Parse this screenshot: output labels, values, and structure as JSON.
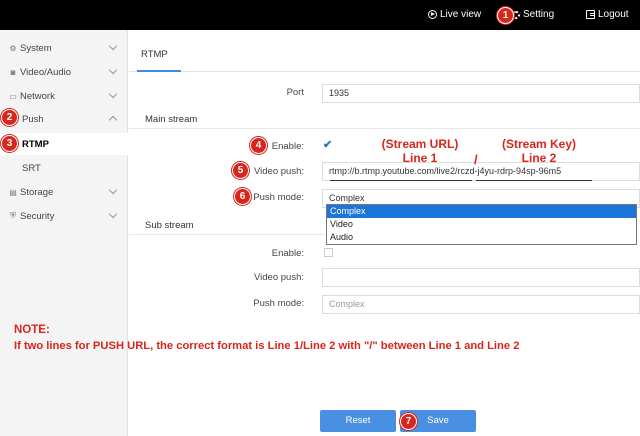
{
  "topbar": {
    "live_view": "Live view",
    "setting": "Setting",
    "logout": "Logout"
  },
  "sidebar": {
    "items": [
      {
        "label": "System",
        "icon": "gear-icon"
      },
      {
        "label": "Video/Audio",
        "icon": "camera-icon"
      },
      {
        "label": "Network",
        "icon": "monitor-icon"
      },
      {
        "label": "Push",
        "icon": ""
      },
      {
        "label": "RTMP",
        "icon": ""
      },
      {
        "label": "SRT",
        "icon": ""
      },
      {
        "label": "Storage",
        "icon": "storage-icon"
      },
      {
        "label": "Security",
        "icon": "shield-icon"
      }
    ]
  },
  "tabs": {
    "active": "RTMP"
  },
  "form": {
    "port_label": "Port",
    "port_value": "1935",
    "main_stream_title": "Main stream",
    "enable_label": "Enable:",
    "enable_checked": true,
    "video_push_label": "Video push:",
    "video_push_value": "rtmp://b.rtmp.youtube.com/live2/rczd-j4yu-rdrp-94sp-96m5",
    "push_mode_label": "Push mode:",
    "push_mode_value": "Complex",
    "push_mode_options": [
      "Complex",
      "Video",
      "Audio"
    ],
    "sub_stream_title": "Sub stream",
    "sub_enable_label": "Enable:",
    "sub_video_push_label": "Video push:",
    "sub_push_mode_label": "Push mode:",
    "sub_push_mode_value": "Complex"
  },
  "annotations": {
    "badges": [
      "1",
      "2",
      "3",
      "4",
      "5",
      "6",
      "7"
    ],
    "stream_url_title": "(Stream URL)",
    "stream_url_line": "Line 1",
    "stream_key_title": "(Stream Key)",
    "stream_key_line": "Line 2",
    "slash": "/",
    "note_title": "NOTE:",
    "note_body": "If two lines for PUSH URL, the correct format is Line 1/Line 2 with \"/\" between Line 1 and Line 2"
  },
  "buttons": {
    "reset": "Reset",
    "save": "Save"
  },
  "colors": {
    "annotation_red": "#d8261c",
    "accent_blue": "#4a90e2",
    "selection_blue": "#1c75d9",
    "topbar_bg": "#000000"
  }
}
